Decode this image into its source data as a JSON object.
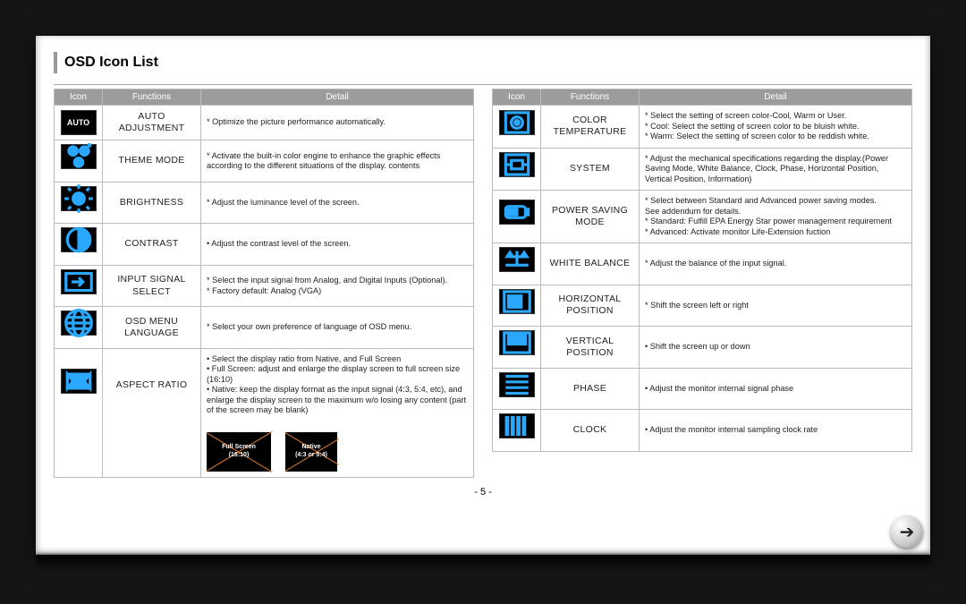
{
  "title": "OSD Icon List",
  "headers": {
    "icon": "Icon",
    "functions": "Functions",
    "detail": "Detail"
  },
  "left": [
    {
      "icon": "auto",
      "function": "AUTO ADJUSTMENT",
      "detail": "* Optimize the picture performance automatically."
    },
    {
      "icon": "theme",
      "function": "THEME MODE",
      "detail": "* Activate the built-in color engine to enhance the graphic effects according to the different situations of the display. contents"
    },
    {
      "icon": "brightness",
      "function": "BRIGHTNESS",
      "detail": "* Adjust the luminance level of the screen."
    },
    {
      "icon": "contrast",
      "function": "CONTRAST",
      "detail": "• Adjust the contrast level of the screen."
    },
    {
      "icon": "input",
      "function": "INPUT SIGNAL SELECT",
      "detail": "* Select the input signal from Analog, and Digital Inputs (Optional).\n* Factory default: Analog (VGA)"
    },
    {
      "icon": "language",
      "function": "OSD MENU LANGUAGE",
      "detail": "* Select your own preference of language of OSD menu."
    },
    {
      "icon": "aspect",
      "function": "ASPECT RATIO",
      "detail": "• Select the display ratio from Native, and Full Screen\n• Full Screen: adjust and enlarge the display screen to full screen size (16:10)\n• Native: keep the display format as the input signal (4:3, 5:4, etc), and enlarge the display screen to the maximum w/o losing any content (part of the screen may be blank)"
    }
  ],
  "right": [
    {
      "icon": "colortemp",
      "function": "COLOR TEMPERATURE",
      "detail": "* Select the setting of screen color-Cool, Warm or User.\n* Cool: Select the setting of screen color to be bluish white.\n* Warm: Select the setting of screen color to be reddish white."
    },
    {
      "icon": "system",
      "function": "SYSTEM",
      "detail": "* Adjust the mechanical specifications regarding the display.(Power Saving Mode, White Balance, Clock, Phase, Horizontal Position, Vertical Position, Information)"
    },
    {
      "icon": "power",
      "function": "POWER SAVING MODE",
      "detail": "* Select between Standard and Advanced power saving modes.\nSee addendum for details.\n* Standard: Fulfill EPA Energy Star power management requirement\n* Advanced: Activate monitor Life-Extension fuction"
    },
    {
      "icon": "whitebal",
      "function": "WHITE BALANCE",
      "detail": "* Adjust the balance of the input signal."
    },
    {
      "icon": "hpos",
      "function": "HORIZONTAL POSITION",
      "detail": "* Shift the screen left or right"
    },
    {
      "icon": "vpos",
      "function": "VERTICAL POSITION",
      "detail": "• Shift the screen up or down"
    },
    {
      "icon": "phase",
      "function": "PHASE",
      "detail": "• Adjust the monitor internal signal phase"
    },
    {
      "icon": "clock",
      "function": "CLOCK",
      "detail": "• Adjust the monitor internal sampling clock rate"
    }
  ],
  "ratio_diagram": {
    "full": {
      "l1": "Full Screen",
      "l2": "(16:10)"
    },
    "native": {
      "l1": "Native",
      "l2": "(4:3 or 5:4)"
    }
  },
  "page_number": "- 5 -"
}
